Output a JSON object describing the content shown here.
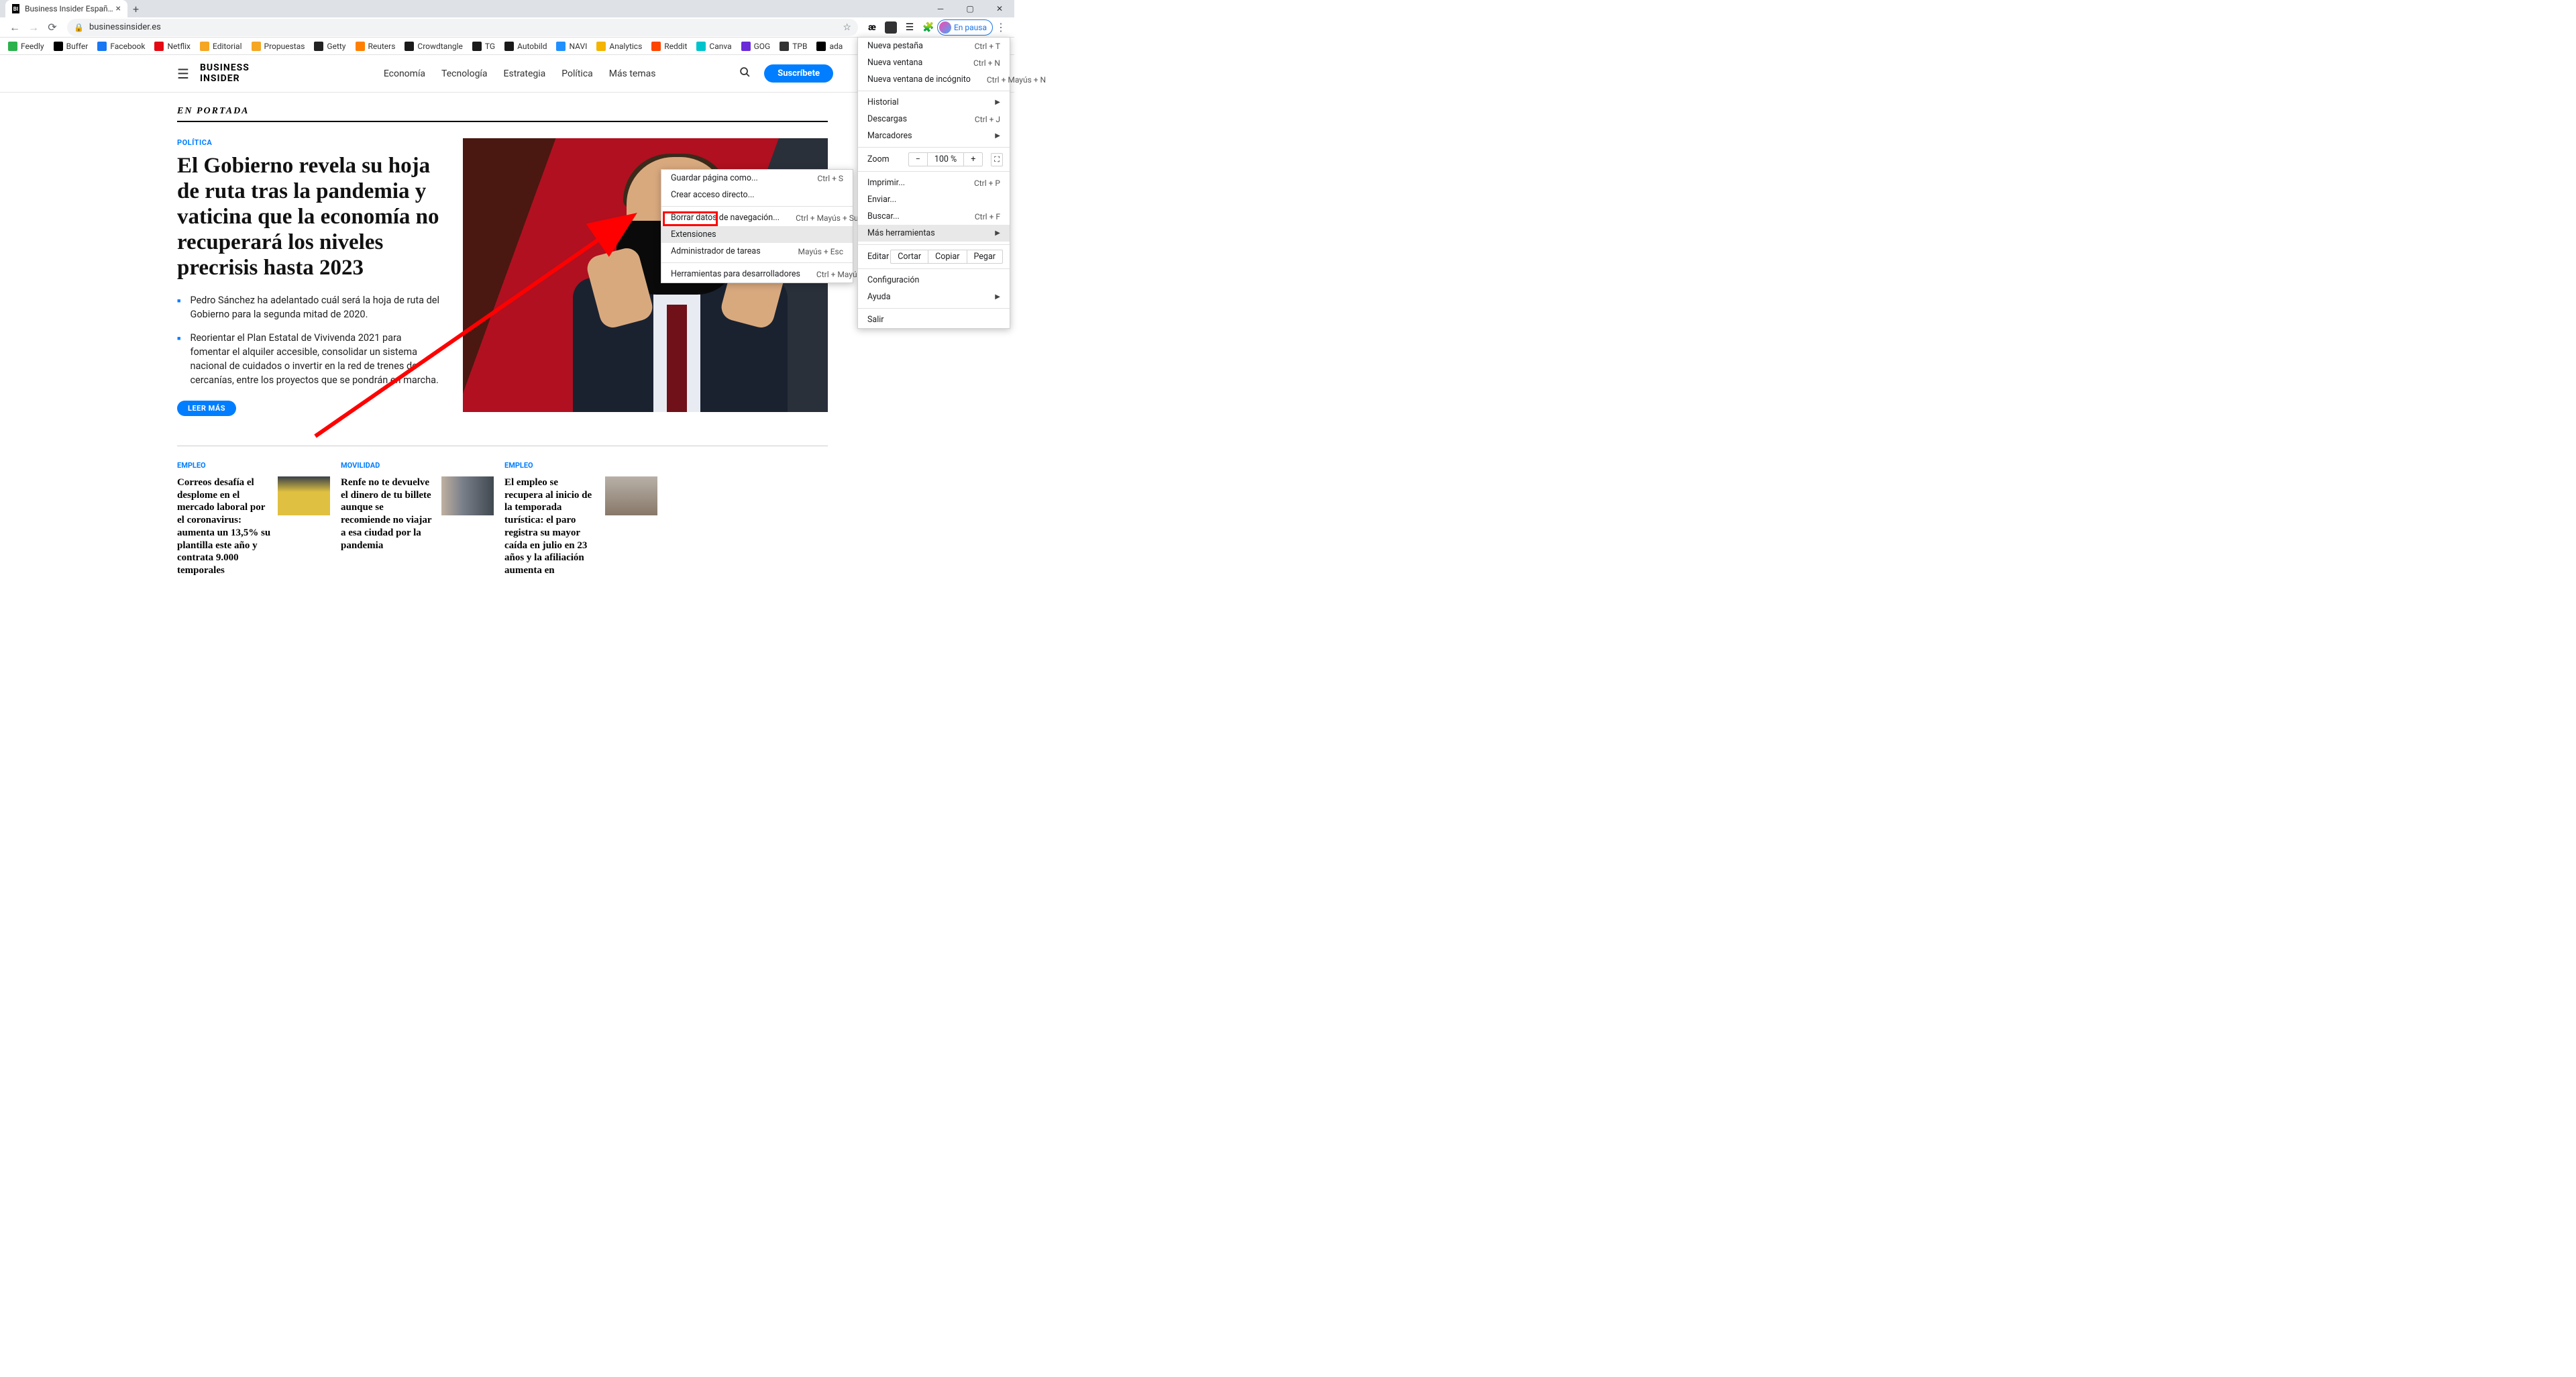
{
  "browser": {
    "tab_title": "Business Insider España: Actuali",
    "tab_favicon": "BI",
    "url": "businessinsider.es",
    "profile_status": "En pausa",
    "bookmarks": [
      {
        "label": "Feedly",
        "color": "#2bb24c"
      },
      {
        "label": "Buffer",
        "color": "#000000"
      },
      {
        "label": "Facebook",
        "color": "#1877f2"
      },
      {
        "label": "Netflix",
        "color": "#e50914"
      },
      {
        "label": "Editorial",
        "color": "#f5a623"
      },
      {
        "label": "Propuestas",
        "color": "#f5a623"
      },
      {
        "label": "Getty",
        "color": "#222222"
      },
      {
        "label": "Reuters",
        "color": "#ff8000"
      },
      {
        "label": "Crowdtangle",
        "color": "#1a1a1a"
      },
      {
        "label": "TG",
        "color": "#1a1a1a"
      },
      {
        "label": "Autobild",
        "color": "#1a1a1a"
      },
      {
        "label": "NAVI",
        "color": "#2090ff"
      },
      {
        "label": "Analytics",
        "color": "#f4b400"
      },
      {
        "label": "Reddit",
        "color": "#ff4500"
      },
      {
        "label": "Canva",
        "color": "#00c4cc"
      },
      {
        "label": "GOG",
        "color": "#6a2bd9"
      },
      {
        "label": "TPB",
        "color": "#333333"
      },
      {
        "label": "ada",
        "color": "#000000"
      }
    ]
  },
  "main_menu": {
    "new_tab": {
      "label": "Nueva pestaña",
      "shortcut": "Ctrl + T"
    },
    "new_window": {
      "label": "Nueva ventana",
      "shortcut": "Ctrl + N"
    },
    "new_incognito": {
      "label": "Nueva ventana de incógnito",
      "shortcut": "Ctrl + Mayús + N"
    },
    "history": {
      "label": "Historial"
    },
    "downloads": {
      "label": "Descargas",
      "shortcut": "Ctrl + J"
    },
    "bookmarks": {
      "label": "Marcadores"
    },
    "zoom": {
      "label": "Zoom",
      "value": "100 %"
    },
    "print": {
      "label": "Imprimir...",
      "shortcut": "Ctrl + P"
    },
    "cast": {
      "label": "Enviar..."
    },
    "find": {
      "label": "Buscar...",
      "shortcut": "Ctrl + F"
    },
    "more_tools": {
      "label": "Más herramientas"
    },
    "edit": {
      "label": "Editar",
      "cut": "Cortar",
      "copy": "Copiar",
      "paste": "Pegar"
    },
    "settings": {
      "label": "Configuración"
    },
    "help": {
      "label": "Ayuda"
    },
    "exit": {
      "label": "Salir"
    }
  },
  "sub_menu": {
    "save_as": {
      "label": "Guardar página como...",
      "shortcut": "Ctrl + S"
    },
    "create_shortcut": {
      "label": "Crear acceso directo..."
    },
    "clear_data": {
      "label": "Borrar datos de navegación...",
      "shortcut": "Ctrl + Mayús + Supr"
    },
    "extensions": {
      "label": "Extensiones"
    },
    "task_manager": {
      "label": "Administrador de tareas",
      "shortcut": "Mayús + Esc"
    },
    "dev_tools": {
      "label": "Herramientas para desarrolladores",
      "shortcut": "Ctrl + Mayús + I"
    }
  },
  "site": {
    "logo_line1": "BUSINESS",
    "logo_line2": "INSIDER",
    "nav": [
      "Economía",
      "Tecnología",
      "Estrategia",
      "Política",
      "Más temas"
    ],
    "subscribe": "Suscríbete",
    "section_heading": "EN PORTADA",
    "lead": {
      "category": "POLÍTICA",
      "headline": "El Gobierno revela su hoja de ruta tras la pandemia y vaticina que la economía no recuperará los niveles precrisis hasta 2023",
      "bullets": [
        "Pedro Sánchez ha adelantado cuál será la hoja de ruta del Gobierno para la segunda mitad de 2020.",
        "Reorientar el Plan Estatal de Vivivenda 2021 para fomentar el alquiler accesible, consolidar un sistema nacional de cuidados o invertir en la red de trenes de cercanías, entre los proyectos que se pondrán en marcha."
      ],
      "read_more": "LEER MÁS"
    },
    "secondary": [
      {
        "category": "EMPLEO",
        "title": "Correos desafía el desplome en el mercado laboral por el coronavirus: aumenta un 13,5% su plantilla este año y contrata 9.000 temporales"
      },
      {
        "category": "MOVILIDAD",
        "title": "Renfe no te devuelve el dinero de tu billete aunque se recomiende no viajar a esa ciudad por la pandemia"
      },
      {
        "category": "EMPLEO",
        "title": "El empleo se recupera al inicio de la temporada turística: el paro registra su mayor caída en julio en 23 años y la afiliación aumenta en"
      }
    ]
  }
}
